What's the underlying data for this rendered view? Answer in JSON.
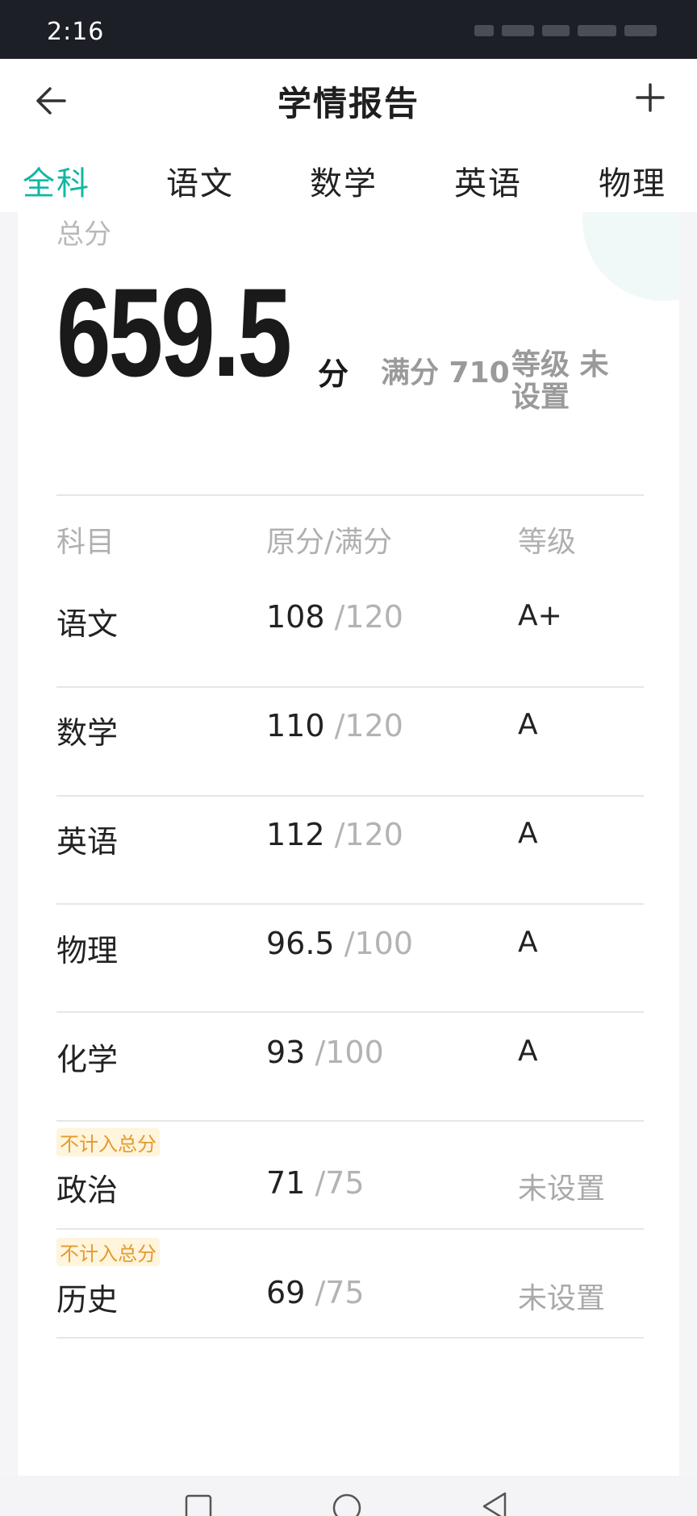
{
  "status_bar": {
    "time": "2:16"
  },
  "header": {
    "title": "学情报告"
  },
  "tabs": [
    {
      "label": "全科"
    },
    {
      "label": "语文"
    },
    {
      "label": "数学"
    },
    {
      "label": "英语"
    },
    {
      "label": "物理"
    }
  ],
  "summary": {
    "label": "总分",
    "score": "659.5",
    "unit": "分",
    "full_text": "满分 710",
    "grade_text": "等级 未设置"
  },
  "table": {
    "headers": [
      "科目",
      "原分/满分",
      "等级"
    ],
    "rows": [
      {
        "subject": "语文",
        "score": "108",
        "full": "/120",
        "grade": "A+",
        "tag": ""
      },
      {
        "subject": "数学",
        "score": "110",
        "full": "/120",
        "grade": "A",
        "tag": ""
      },
      {
        "subject": "英语",
        "score": "112",
        "full": "/120",
        "grade": "A",
        "tag": ""
      },
      {
        "subject": "物理",
        "score": "96.5",
        "full": "/100",
        "grade": "A",
        "tag": ""
      },
      {
        "subject": "化学",
        "score": "93",
        "full": "/100",
        "grade": "A",
        "tag": ""
      },
      {
        "subject": "政治",
        "score": "71",
        "full": "/75",
        "grade": "未设置",
        "tag": "不计入总分"
      },
      {
        "subject": "历史",
        "score": "69",
        "full": "/75",
        "grade": "未设置",
        "tag": "不计入总分"
      }
    ]
  },
  "colors": {
    "accent": "#12b7a3",
    "tag": "#e39b2d"
  },
  "icons": {
    "back": "arrow-left",
    "add": "plus",
    "nav": [
      "square",
      "circle",
      "triangle-back"
    ]
  }
}
